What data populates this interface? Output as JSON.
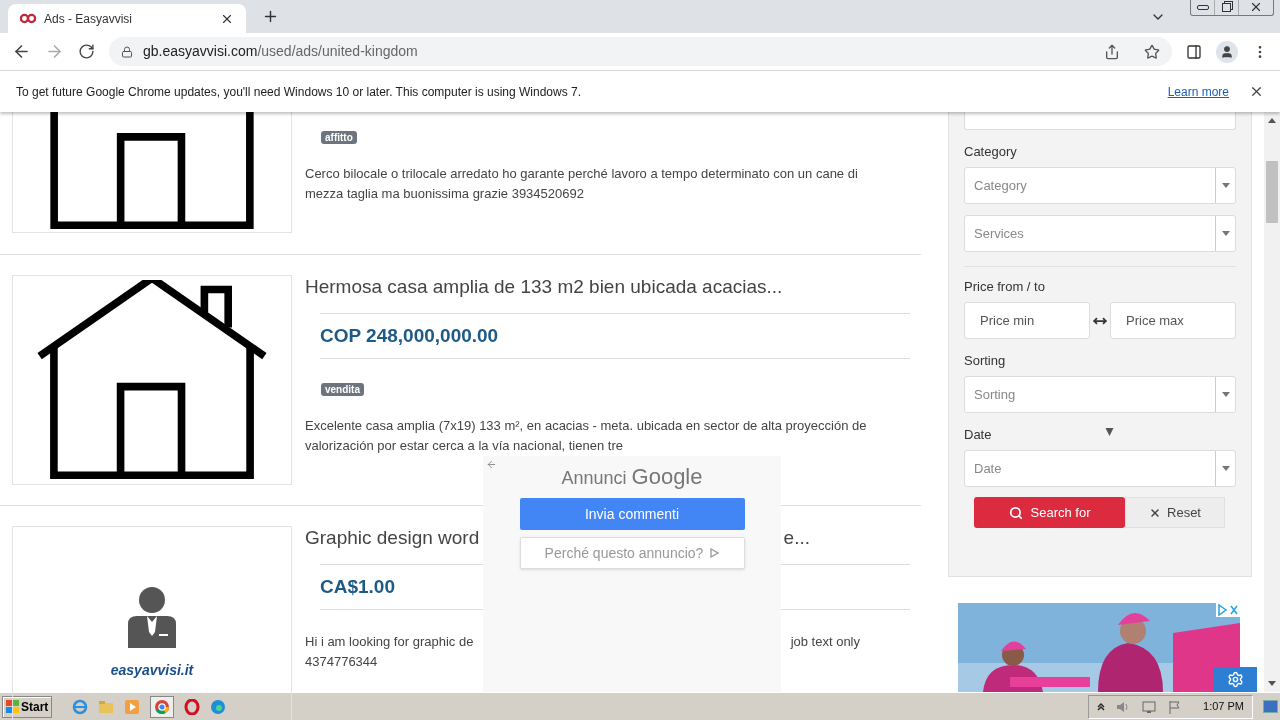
{
  "browser": {
    "tab": {
      "title": "Ads - Easyavvisi",
      "selected": true
    },
    "address": {
      "host": "gb.easyavvisi.com",
      "path": "/used/ads/united-kingdom"
    },
    "infobar": {
      "message": "To get future Google Chrome updates, you'll need Windows 10 or later. This computer is using Windows 7.",
      "link": "Learn more"
    }
  },
  "listings": [
    {
      "image": {
        "kind": "house"
      },
      "tag": "affitto",
      "description_lines": [
        [
          "Cerco bilocale o trilocale arredato ho garante perché lavoro a tempo determinato con un cane di"
        ],
        [
          "mezza taglia ma buonissima grazie 3934520692"
        ]
      ]
    },
    {
      "image": {
        "kind": "house"
      },
      "title": [
        "Hermosa casa amplia de 133 m2 bien ubicada acacias..."
      ],
      "price": "COP 248,000,000.00",
      "tag": "vendita",
      "description_lines": [
        [
          "Excelente casa amplia (7x19) 133 m², en acacias - meta. ubicada en sector de alta proyección de"
        ],
        [
          "valorización por estar cerca a la vía nacional, tienen tre"
        ]
      ]
    },
    {
      "image": {
        "kind": "logo",
        "caption": "easyavvisi.it"
      },
      "title": [
        "Graphic design word",
        "e..."
      ],
      "price": "CA$1.00",
      "description_lines": [
        [
          "Hi i am looking for graphic de",
          "job text only"
        ],
        [
          "4374776344"
        ]
      ]
    }
  ],
  "filters": {
    "sections": [
      {
        "label": "Category",
        "controls": [
          {
            "kind": "select",
            "placeholder": "Category"
          },
          {
            "kind": "select",
            "placeholder": "Services"
          }
        ]
      },
      {
        "label": "Price from / to",
        "controls": [
          {
            "kind": "range",
            "min_placeholder": "Price min",
            "max_placeholder": "Price max"
          }
        ]
      },
      {
        "label": "Sorting",
        "controls": [
          {
            "kind": "select",
            "placeholder": "Sorting"
          }
        ]
      },
      {
        "label": "Date",
        "controls": [
          {
            "kind": "select",
            "placeholder": "Date"
          }
        ]
      }
    ],
    "search_button": "Search for",
    "reset_button": "Reset"
  },
  "ad_popup": {
    "heading": "Annunci",
    "brand": "Google",
    "feedback_button": "Invia commenti",
    "why_button": "Perché questo annuncio?"
  },
  "taskbar": {
    "start": "Start",
    "time": "1:07 PM"
  }
}
